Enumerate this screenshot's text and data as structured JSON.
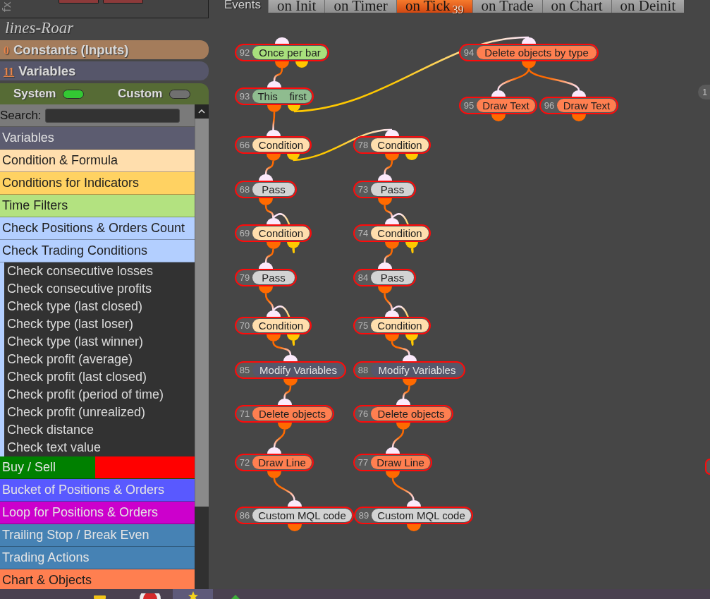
{
  "sidebar": {
    "side_label": "fx",
    "title": "lines-Roar",
    "sections": [
      {
        "count": "0",
        "label": "Constants (Inputs)",
        "kind": "constants",
        "color": "#a47c5b"
      },
      {
        "count": "11",
        "label": "Variables",
        "kind": "variables",
        "color": "#56566a"
      }
    ],
    "toggles": [
      {
        "label": "System",
        "on": true
      },
      {
        "label": "Custom",
        "on": false
      }
    ],
    "search": {
      "label": "Search:"
    },
    "categories": [
      {
        "label": "Variables",
        "kind": "plain",
        "color": "#5c5c70"
      },
      {
        "label": "Condition & Formula",
        "kind": "plain",
        "color": "#ffdead"
      },
      {
        "label": "Conditions for Indicators",
        "kind": "plain",
        "color": "#ffd262"
      },
      {
        "label": "Time Filters",
        "kind": "plain",
        "color": "#b3e280"
      },
      {
        "label": "Check Positions & Orders Count",
        "kind": "plain",
        "color": "#b3cfff"
      },
      {
        "label": "Check Trading Conditions",
        "kind": "plain",
        "color": "#b3cfff",
        "children": [
          {
            "label": "Check consecutive losses"
          },
          {
            "label": "Check consecutive profits"
          },
          {
            "label": "Check type (last closed)"
          },
          {
            "label": "Check type (last loser)"
          },
          {
            "label": "Check type (last winner)"
          },
          {
            "label": "Check profit (average)"
          },
          {
            "label": "Check profit (last closed)"
          },
          {
            "label": "Check profit (period of time)"
          },
          {
            "label": "Check profit (unrealized)"
          },
          {
            "label": "Check distance"
          },
          {
            "label": "Check text value"
          }
        ]
      },
      {
        "label": "Buy / Sell",
        "kind": "split",
        "segments": [
          {
            "color": "#008000"
          },
          {
            "color": "#ff0000"
          }
        ]
      },
      {
        "label": "Bucket of Positions & Orders",
        "kind": "plain",
        "color": "#5959ff"
      },
      {
        "label": "Loop for Positions & Orders",
        "kind": "plain",
        "color": "#cc00cc"
      },
      {
        "label": "Trailing Stop / Break Even",
        "kind": "plain",
        "color": "#4682b4"
      },
      {
        "label": "Trading Actions",
        "kind": "plain",
        "color": "#4682b4"
      },
      {
        "label": "Chart & Objects",
        "kind": "plain",
        "color": "#ff7f50"
      }
    ]
  },
  "events": {
    "label": "Events",
    "tabs": [
      {
        "label": "on Init",
        "selected": false
      },
      {
        "label": "on Timer",
        "selected": false
      },
      {
        "label": "on Tick",
        "selected": true,
        "badge": "39"
      },
      {
        "label": "on Trade",
        "selected": false
      },
      {
        "label": "on Chart",
        "selected": false
      },
      {
        "label": "on Deinit",
        "selected": false
      }
    ]
  },
  "canvas": {
    "nodes": [
      {
        "number": "92",
        "label": "Once per bar",
        "color": "#a8e07c",
        "alt_output": true
      },
      {
        "number": "94",
        "label": "Delete objects by type",
        "color": "#ff7f50",
        "alt_output": false
      },
      {
        "number": "93",
        "label": "This    first",
        "color": "#8fbc8f",
        "alt_output": true
      },
      {
        "number": "95",
        "label": "Draw Text",
        "color": "#ff7f50",
        "alt_output": false
      },
      {
        "number": "96",
        "label": "Draw Text",
        "color": "#ff7f50",
        "alt_output": false
      },
      {
        "number": "66",
        "label": "Condition",
        "color": "#ffdead",
        "alt_output": true
      },
      {
        "number": "78",
        "label": "Condition",
        "color": "#ffdead",
        "alt_output": true
      },
      {
        "number": "68",
        "label": "Pass",
        "color": "#d3d3d3",
        "alt_output": false
      },
      {
        "number": "73",
        "label": "Pass",
        "color": "#d3d3d3",
        "alt_output": false
      },
      {
        "number": "69",
        "label": "Condition",
        "color": "#ffdead",
        "alt_output": true
      },
      {
        "number": "74",
        "label": "Condition",
        "color": "#ffdead",
        "alt_output": true
      },
      {
        "number": "79",
        "label": "Pass",
        "color": "#d3d3d3",
        "alt_output": false
      },
      {
        "number": "84",
        "label": "Pass",
        "color": "#d3d3d3",
        "alt_output": false
      },
      {
        "number": "70",
        "label": "Condition",
        "color": "#ffdead",
        "alt_output": true
      },
      {
        "number": "75",
        "label": "Condition",
        "color": "#ffdead",
        "alt_output": true
      },
      {
        "number": "85",
        "label": "Modify Variables",
        "color": "#55566a",
        "alt_output": false
      },
      {
        "number": "88",
        "label": "Modify Variables",
        "color": "#55566a",
        "alt_output": false
      },
      {
        "number": "71",
        "label": "Delete objects",
        "color": "#ff7f50",
        "alt_output": false
      },
      {
        "number": "76",
        "label": "Delete objects",
        "color": "#ff7f50",
        "alt_output": false
      },
      {
        "number": "72",
        "label": "Draw Line",
        "color": "#ff7f50",
        "alt_output": false
      },
      {
        "number": "77",
        "label": "Draw Line",
        "color": "#ff7f50",
        "alt_output": false
      },
      {
        "number": "86",
        "label": "Custom MQL code",
        "color": "#d3d3d3",
        "alt_output": false
      },
      {
        "number": "89",
        "label": "Custom MQL code",
        "color": "#d3d3d3",
        "alt_output": false
      }
    ],
    "clipped_nodes": [
      {
        "kind": "number-tab",
        "number": "1"
      },
      {
        "kind": "edge"
      }
    ]
  }
}
